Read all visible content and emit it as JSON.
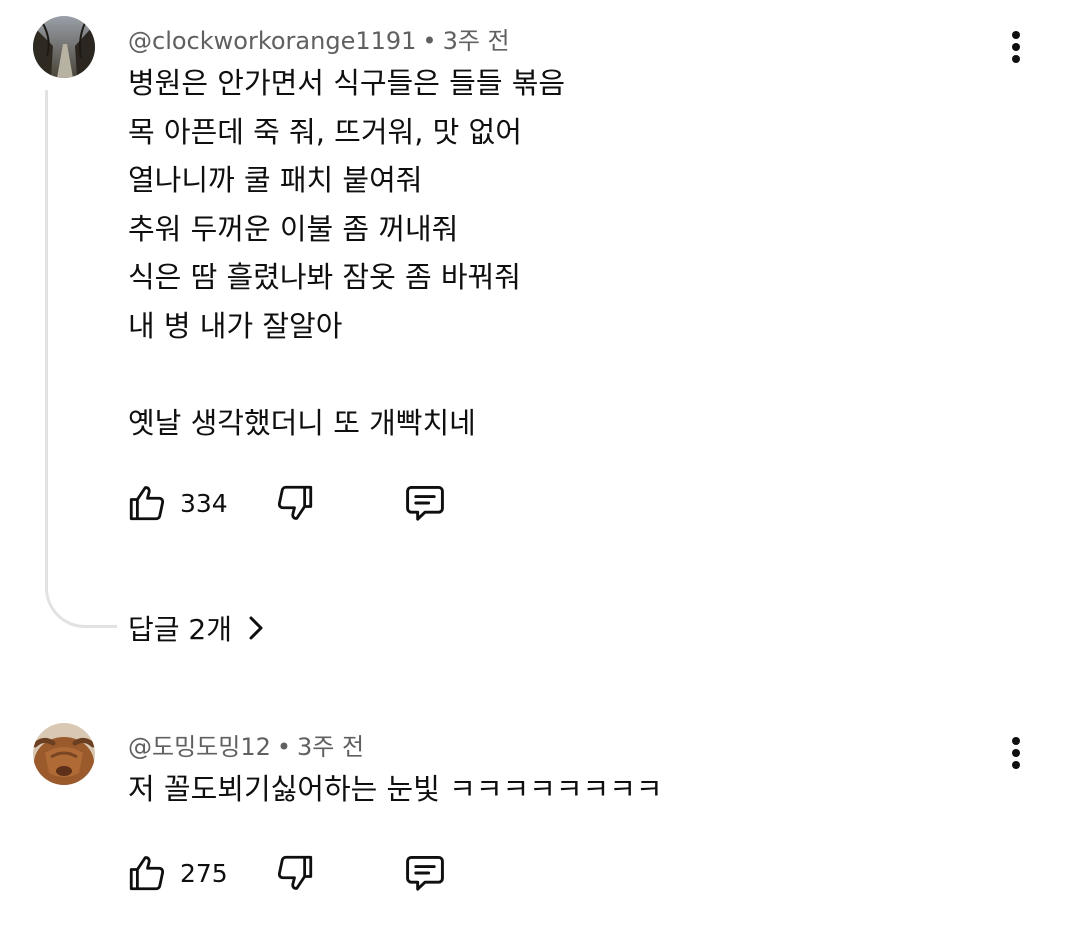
{
  "comments": [
    {
      "author": "@clockworkorange1191",
      "time": "3주 전",
      "lines": [
        "병원은 안가면서 식구들은 들들 볶음",
        "목 아픈데 죽 줘, 뜨거워, 맛 없어",
        "열나니까 쿨 패치 붙여줘",
        "추워 두꺼운 이불 좀 꺼내줘",
        "식은 땀 흘렸나봐 잠옷 좀 바꿔줘",
        "내 병 내가 잘알아",
        "",
        "옛날 생각했더니 또 개빡치네"
      ],
      "likes": "334",
      "replies_label": "답글 2개"
    },
    {
      "author": "@도밍도밍12",
      "time": "3주 전",
      "lines": [
        "저 꼴도뵈기싫어하는 눈빛 ㅋㅋㅋㅋㅋㅋㅋㅋ"
      ],
      "likes": "275"
    }
  ],
  "icons": {
    "like": "thumb-up-icon",
    "dislike": "thumb-down-icon",
    "reply": "comment-icon",
    "menu": "more-vert-icon",
    "expand": "chevron-right-icon"
  },
  "colors": {
    "meta": "#606060",
    "text": "#0f0f0f",
    "thread": "#e2e2e2"
  }
}
